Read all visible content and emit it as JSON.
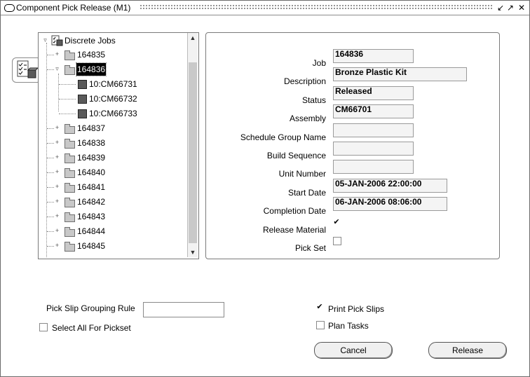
{
  "window": {
    "title": "Component Pick Release (M1)"
  },
  "tree": {
    "root": "Discrete Jobs",
    "items": [
      {
        "label": "164835"
      },
      {
        "label": "164836"
      },
      {
        "label": "10:CM66731"
      },
      {
        "label": "10:CM66732"
      },
      {
        "label": "10:CM66733"
      },
      {
        "label": "164837"
      },
      {
        "label": "164838"
      },
      {
        "label": "164839"
      },
      {
        "label": "164840"
      },
      {
        "label": "164841"
      },
      {
        "label": "164842"
      },
      {
        "label": "164843"
      },
      {
        "label": "164844"
      },
      {
        "label": "164845"
      }
    ],
    "selected": "164836"
  },
  "details": {
    "job_label": "Job",
    "job_value": "164836",
    "description_label": "Description",
    "description_value": "Bronze Plastic Kit",
    "status_label": "Status",
    "status_value": "Released",
    "assembly_label": "Assembly",
    "assembly_value": "CM66701",
    "schedule_group_label": "Schedule Group Name",
    "build_sequence_label": "Build Sequence",
    "unit_number_label": "Unit Number",
    "start_date_label": "Start Date",
    "start_date_value": "05-JAN-2006 22:00:00",
    "completion_date_label": "Completion Date",
    "completion_date_value": "06-JAN-2006 08:06:00",
    "release_material_label": "Release Material",
    "release_material_checked": true,
    "pick_set_label": "Pick Set",
    "pick_set_checked": false
  },
  "options": {
    "grouping_rule_label": "Pick Slip Grouping Rule",
    "grouping_rule_value": "",
    "select_all_label": "Select All For Pickset",
    "print_pick_slips_label": "Print Pick Slips",
    "print_pick_slips_checked": true,
    "plan_tasks_label": "Plan Tasks",
    "plan_tasks_checked": false
  },
  "buttons": {
    "cancel": "Cancel",
    "release": "Release"
  },
  "icons": {
    "window": "window-icon",
    "minimize": "minimize-icon",
    "maximize": "maximize-icon",
    "close": "close-icon",
    "folder": "folder-icon",
    "operation": "cube-icon",
    "checklist": "checklist-icon"
  }
}
